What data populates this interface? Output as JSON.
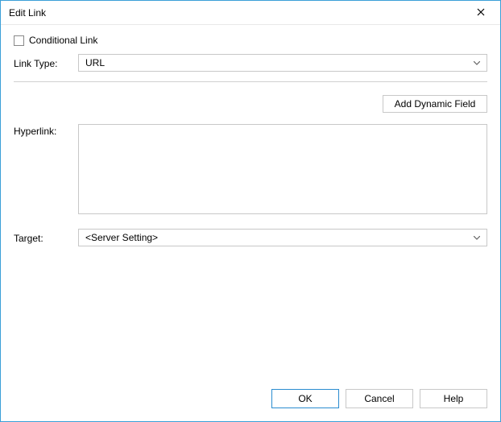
{
  "title": "Edit Link",
  "checkbox": {
    "label": "Conditional Link",
    "checked": false
  },
  "linkType": {
    "label": "Link Type:",
    "value": "URL"
  },
  "divider": true,
  "addDynamicField": {
    "label": "Add Dynamic Field"
  },
  "hyperlink": {
    "label": "Hyperlink:",
    "value": ""
  },
  "target": {
    "label": "Target:",
    "value": "<Server Setting>"
  },
  "buttons": {
    "ok": "OK",
    "cancel": "Cancel",
    "help": "Help"
  }
}
